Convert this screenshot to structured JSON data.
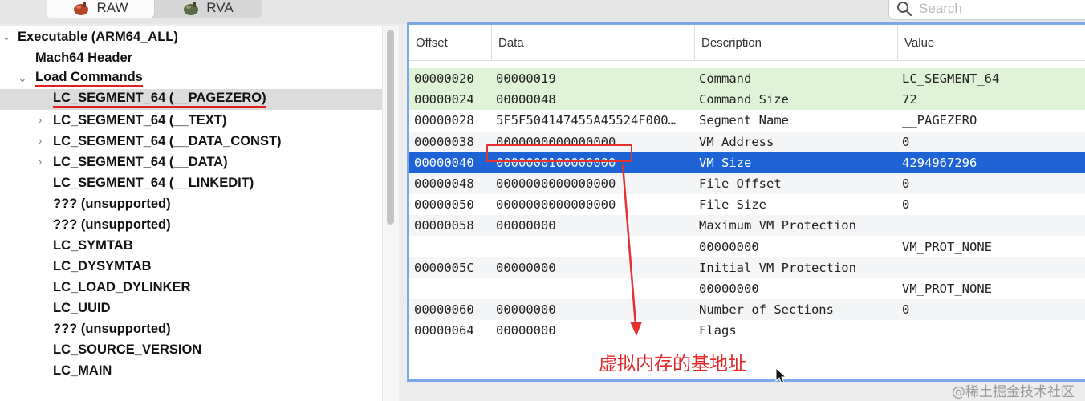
{
  "toolbar": {
    "raw_label": "RAW",
    "rva_label": "RVA",
    "search_placeholder": "Search"
  },
  "tree": {
    "root": "Executable  (ARM64_ALL)",
    "mach_header": "Mach64 Header",
    "load_commands": "Load Commands",
    "items": [
      "LC_SEGMENT_64 (__PAGEZERO)",
      "LC_SEGMENT_64 (__TEXT)",
      "LC_SEGMENT_64 (__DATA_CONST)",
      "LC_SEGMENT_64 (__DATA)",
      "LC_SEGMENT_64 (__LINKEDIT)",
      "??? (unsupported)",
      "??? (unsupported)",
      "LC_SYMTAB",
      "LC_DYSYMTAB",
      "LC_LOAD_DYLINKER",
      "LC_UUID",
      "??? (unsupported)",
      "LC_SOURCE_VERSION",
      "LC_MAIN"
    ]
  },
  "table": {
    "headers": [
      "Offset",
      "Data",
      "Description",
      "Value"
    ],
    "rows": [
      {
        "offset": "00000020",
        "data": "00000019",
        "desc": "Command",
        "value": "LC_SEGMENT_64"
      },
      {
        "offset": "00000024",
        "data": "00000048",
        "desc": "Command Size",
        "value": "72"
      },
      {
        "offset": "00000028",
        "data": "5F5F504147455A45524F000…",
        "desc": "Segment Name",
        "value": "__PAGEZERO"
      },
      {
        "offset": "00000038",
        "data": "0000000000000000",
        "desc": "VM Address",
        "value": "0"
      },
      {
        "offset": "00000040",
        "data": "0000000100000000",
        "desc": "VM Size",
        "value": "4294967296"
      },
      {
        "offset": "00000048",
        "data": "0000000000000000",
        "desc": "File Offset",
        "value": "0"
      },
      {
        "offset": "00000050",
        "data": "0000000000000000",
        "desc": "File Size",
        "value": "0"
      },
      {
        "offset": "00000058",
        "data": "00000000",
        "desc": "Maximum VM Protection",
        "value": ""
      },
      {
        "offset": "",
        "data": "",
        "desc": "00000000",
        "value": "VM_PROT_NONE"
      },
      {
        "offset": "0000005C",
        "data": "00000000",
        "desc": "Initial VM Protection",
        "value": ""
      },
      {
        "offset": "",
        "data": "",
        "desc": "00000000",
        "value": "VM_PROT_NONE"
      },
      {
        "offset": "00000060",
        "data": "00000000",
        "desc": "Number of Sections",
        "value": "0"
      },
      {
        "offset": "00000064",
        "data": "00000000",
        "desc": "Flags",
        "value": ""
      }
    ]
  },
  "annotation": "虚拟内存的基地址",
  "watermark": "@稀土掘金技术社区",
  "colors": {
    "selection": "#1d63d6",
    "green_row": "#dff3d6",
    "annotation_red": "#e02a2a",
    "table_focus": "#7aa8e8"
  }
}
